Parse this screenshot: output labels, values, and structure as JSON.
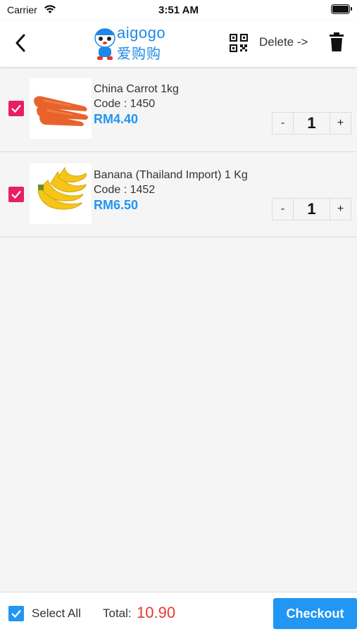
{
  "status_bar": {
    "carrier": "Carrier",
    "time": "3:51 AM"
  },
  "nav": {
    "back_icon": "chevron-left-icon",
    "logo": {
      "text": "aigogo",
      "cn": "爱购购"
    },
    "qr_icon": "qr-code-icon",
    "delete_label": "Delete ->",
    "trash_icon": "trash-icon"
  },
  "cart": {
    "items": [
      {
        "name": "China Carrot 1kg",
        "code": "Code : 1450",
        "price": "RM4.40",
        "quantity": "1",
        "checked": true,
        "image": "carrot-image",
        "minus": "-",
        "plus": "+"
      },
      {
        "name": "Banana (Thailand Import) 1 Kg",
        "code": "Code : 1452",
        "price": "RM6.50",
        "quantity": "1",
        "checked": true,
        "image": "banana-image",
        "minus": "-",
        "plus": "+"
      }
    ]
  },
  "bottom": {
    "select_all_label": "Select All",
    "total_label": "Total:",
    "total_value": "10.90",
    "checkout_label": "Checkout"
  },
  "colors": {
    "accent": "#2196f3",
    "check_pink": "#e91e63",
    "total_red": "#e53935"
  }
}
